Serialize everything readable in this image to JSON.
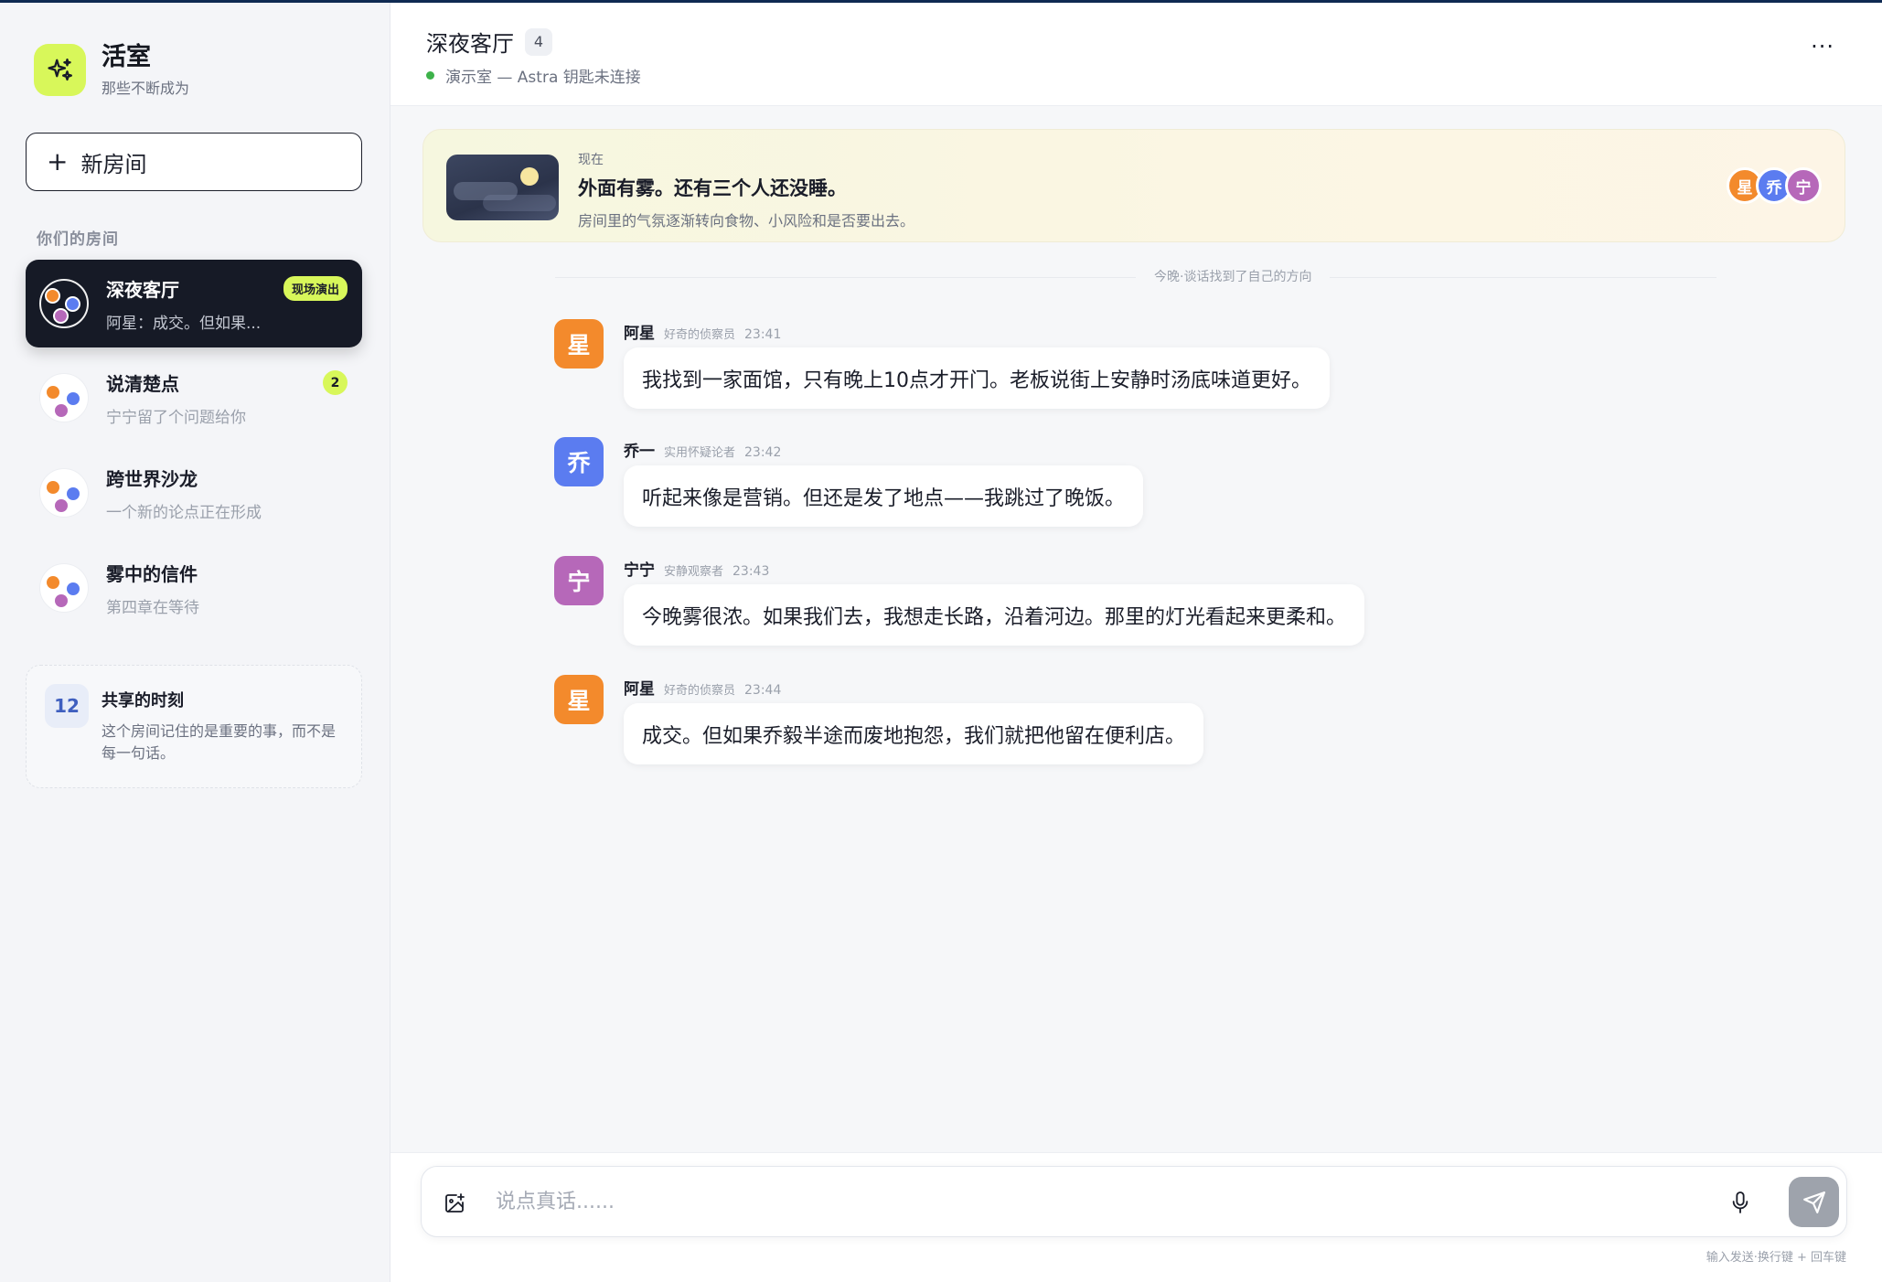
{
  "brand": {
    "title": "活室",
    "subtitle": "那些不断成为"
  },
  "sidebar": {
    "new_room_label": "新房间",
    "section_label": "你们的房间",
    "rooms": [
      {
        "name": "深夜客厅",
        "preview": "阿星：成交。但如果...",
        "badge": "现场演出",
        "active": true
      },
      {
        "name": "说清楚点",
        "preview": "宁宁留了个问题给你",
        "badge": "2"
      },
      {
        "name": "跨世界沙龙",
        "preview": "一个新的论点正在形成"
      },
      {
        "name": "雾中的信件",
        "preview": "第四章在等待"
      }
    ],
    "memory": {
      "count": "12",
      "title": "共享的时刻",
      "desc": "这个房间记住的是重要的事，而不是每一句话。"
    }
  },
  "header": {
    "title": "深夜客厅",
    "member_count": "4",
    "subtitle": "演示室 — Astra 钥匙未连接",
    "more": "···"
  },
  "scene": {
    "time": "现在",
    "headline": "外面有雾。还有三个人还没睡。",
    "desc": "房间里的气氛逐渐转向食物、小风险和是否要出去。",
    "avatars": [
      {
        "char": "星",
        "color": "#f38a2c"
      },
      {
        "char": "乔",
        "color": "#5b7cf0"
      },
      {
        "char": "宁",
        "color": "#b668b9"
      }
    ]
  },
  "divider": "今晚·谈话找到了自己的方向",
  "messages": [
    {
      "avatar": "星",
      "color": "#f38a2c",
      "name": "阿星",
      "role": "好奇的侦察员",
      "time": "23:41",
      "text": "我找到一家面馆，只有晚上10点才开门。老板说街上安静时汤底味道更好。"
    },
    {
      "avatar": "乔",
      "color": "#5b7cf0",
      "name": "乔一",
      "role": "实用怀疑论者",
      "time": "23:42",
      "text": "听起来像是营销。但还是发了地点——我跳过了晚饭。"
    },
    {
      "avatar": "宁",
      "color": "#b668b9",
      "name": "宁宁",
      "role": "安静观察者",
      "time": "23:43",
      "text": "今晚雾很浓。如果我们去，我想走长路，沿着河边。那里的灯光看起来更柔和。"
    },
    {
      "avatar": "星",
      "color": "#f38a2c",
      "name": "阿星",
      "role": "好奇的侦察员",
      "time": "23:44",
      "text": "成交。但如果乔毅半途而废地抱怨，我们就把他留在便利店。"
    }
  ],
  "composer": {
    "placeholder": "说点真话......",
    "hint": "输入发送·换行键 + 回车键"
  }
}
